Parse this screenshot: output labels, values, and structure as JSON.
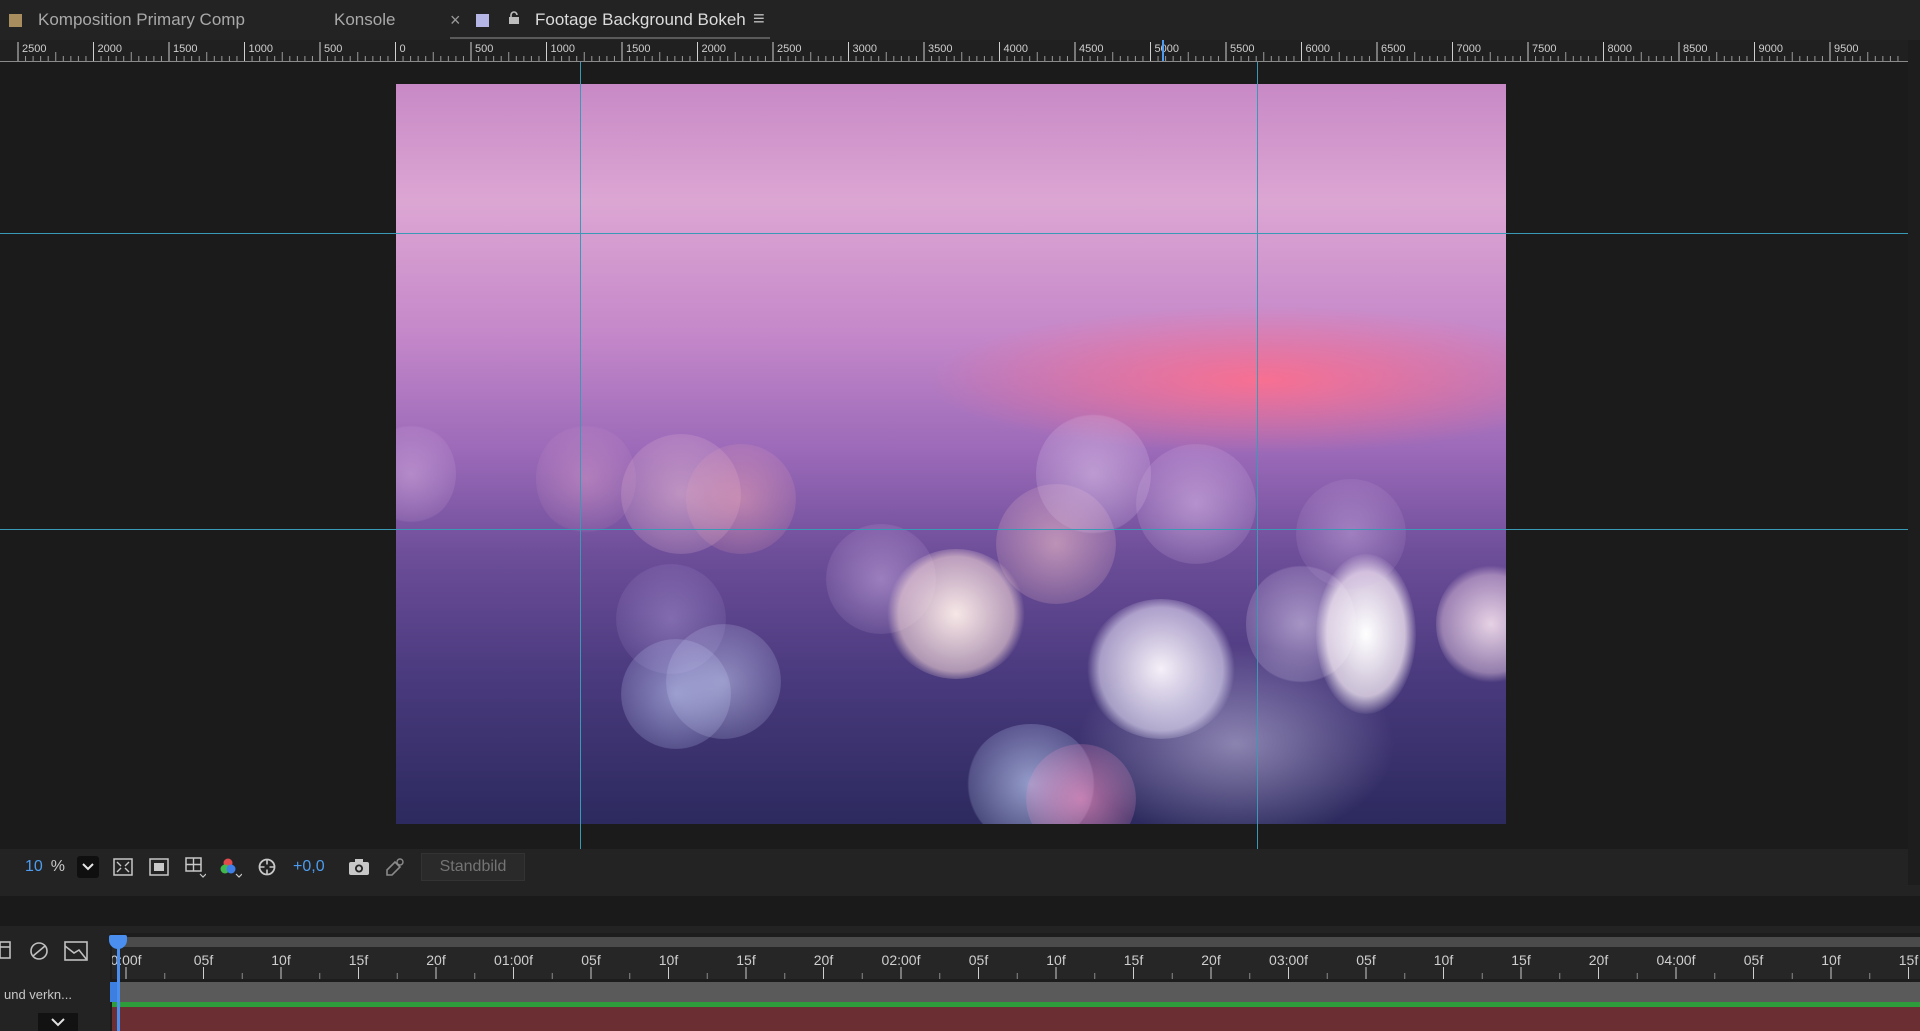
{
  "tabs": {
    "composition": "Komposition Primary Comp",
    "console": "Konsole",
    "close": "×",
    "footage": "Footage Background Bokeh",
    "menu": "≡",
    "composition_color": "#a88d5e",
    "footage_color": "#b6b6e6"
  },
  "ruler": {
    "labels": [
      "2500",
      "2000",
      "1500",
      "1000",
      "500",
      "0",
      "500",
      "1000",
      "1500",
      "2000",
      "2500",
      "3000",
      "3500",
      "4000",
      "4500",
      "5000",
      "5500",
      "6000",
      "6500",
      "7000",
      "7500",
      "8000",
      "8500",
      "9000",
      "9500"
    ]
  },
  "viewer": {
    "zoom": "10",
    "zoom_unit": "%",
    "exposure": "+0,0",
    "snapshot_mode": "Standbild",
    "guide_color": "#3a9ab6",
    "active_border_color": "#2e68b0"
  },
  "timeline": {
    "labels": [
      "0:00f",
      "05f",
      "10f",
      "15f",
      "20f",
      "01:00f",
      "05f",
      "10f",
      "15f",
      "20f",
      "02:00f",
      "05f",
      "10f",
      "15f",
      "20f",
      "03:00f",
      "05f",
      "10f",
      "15f",
      "20f",
      "04:00f",
      "05f",
      "10f",
      "15f"
    ],
    "layer_label": "und verkn...",
    "chevron": "⌄",
    "clip_color": "#6b2f33",
    "work_area_color": "#2e9c3a"
  }
}
